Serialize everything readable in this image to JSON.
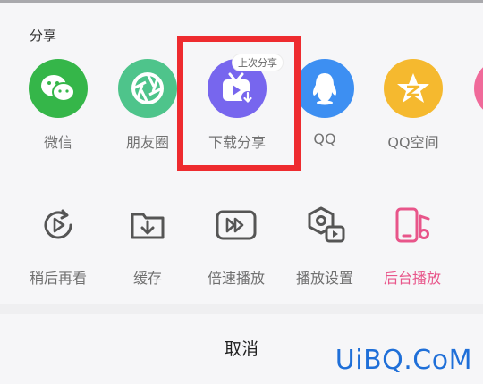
{
  "share": {
    "title": "分享",
    "badge": "上次分享",
    "items": [
      {
        "label": "微信",
        "icon": "wechat-icon",
        "color": "#35b649"
      },
      {
        "label": "朋友圈",
        "icon": "moments-aperture-icon",
        "color": "#4ec48b"
      },
      {
        "label": "下载分享",
        "icon": "download-tv-icon",
        "color": "#7766ee"
      },
      {
        "label": "QQ",
        "icon": "qq-penguin-icon",
        "color": "#3d8ff2"
      },
      {
        "label": "QQ空间",
        "icon": "qzone-star-icon",
        "color": "#f5b92f"
      }
    ]
  },
  "actions": {
    "items": [
      {
        "label": "稍后再看",
        "icon": "watch-later-icon"
      },
      {
        "label": "缓存",
        "icon": "cache-download-icon"
      },
      {
        "label": "倍速播放",
        "icon": "playback-speed-icon"
      },
      {
        "label": "播放设置",
        "icon": "playback-settings-icon"
      },
      {
        "label": "后台播放",
        "icon": "background-play-icon",
        "active_color": "#e8558a"
      }
    ]
  },
  "cancel": {
    "label": "取消"
  },
  "watermark": "UiBQ.CoM",
  "colors": {
    "highlight": "#ee2b2f",
    "text": "#737373",
    "pink": "#e8558a"
  }
}
